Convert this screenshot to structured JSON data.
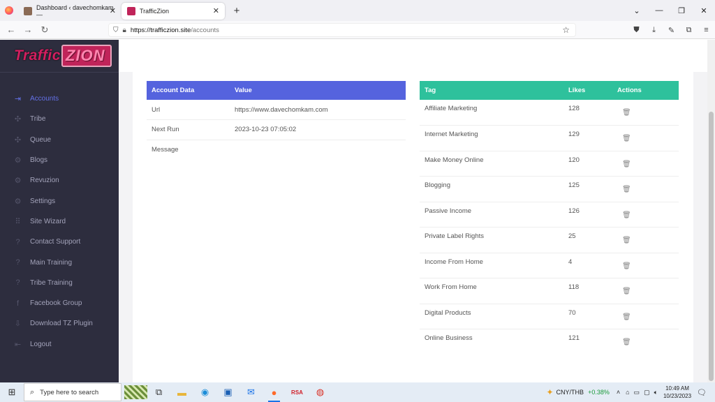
{
  "browser": {
    "tabs": [
      {
        "title": "Dashboard ‹ davechomkam —",
        "close": "✕"
      },
      {
        "title": "TrafficZion",
        "close": "✕"
      }
    ],
    "new_tab": "+",
    "url_host": "https://trafficzion.site",
    "url_path": "/accounts",
    "window_controls": [
      "⌄",
      "—",
      "❐",
      "✕"
    ]
  },
  "logo": {
    "part1": "Traffic",
    "part2": "ZION"
  },
  "sidebar": {
    "items": [
      {
        "label": "Accounts",
        "icon": "login-icon",
        "glyph": "⇥",
        "active": true
      },
      {
        "label": "Tribe",
        "icon": "network-icon",
        "glyph": "✣"
      },
      {
        "label": "Queue",
        "icon": "network-icon",
        "glyph": "✣"
      },
      {
        "label": "Blogs",
        "icon": "gear-icon",
        "glyph": "⚙"
      },
      {
        "label": "Revuzion",
        "icon": "gear-icon",
        "glyph": "⚙"
      },
      {
        "label": "Settings",
        "icon": "gear-icon",
        "glyph": "⚙"
      },
      {
        "label": "Site Wizard",
        "icon": "grid-icon",
        "glyph": "⠿"
      },
      {
        "label": "Contact Support",
        "icon": "help-icon",
        "glyph": "?"
      },
      {
        "label": "Main Training",
        "icon": "help-icon",
        "glyph": "?"
      },
      {
        "label": "Tribe Training",
        "icon": "help-icon",
        "glyph": "?"
      },
      {
        "label": "Facebook Group",
        "icon": "facebook-icon",
        "glyph": "f"
      },
      {
        "label": "Download TZ Plugin",
        "icon": "download-icon",
        "glyph": "⇩"
      },
      {
        "label": "Logout",
        "icon": "logout-icon",
        "glyph": "⇤"
      }
    ]
  },
  "account_table": {
    "headers": [
      "Account Data",
      "Value"
    ],
    "rows": [
      [
        "Url",
        "https://www.davechomkam.com"
      ],
      [
        "Next Run",
        "2023-10-23 07:05:02"
      ],
      [
        "Message",
        ""
      ]
    ]
  },
  "tag_table": {
    "headers": [
      "Tag",
      "Likes",
      "Actions"
    ],
    "rows": [
      [
        "Affiliate Marketing",
        "128"
      ],
      [
        "Internet Marketing",
        "129"
      ],
      [
        "Make Money Online",
        "120"
      ],
      [
        "Blogging",
        "125"
      ],
      [
        "Passive Income",
        "126"
      ],
      [
        "Private Label Rights",
        "25"
      ],
      [
        "Income From Home",
        "4"
      ],
      [
        "Work From Home",
        "118"
      ],
      [
        "Digital Products",
        "70"
      ],
      [
        "Online Business",
        "121"
      ]
    ],
    "action_icon": "🗑"
  },
  "taskbar": {
    "search_placeholder": "Type here to search",
    "ticker_pair": "CNY/THB",
    "ticker_change": "+0.38%",
    "time": "10:49 AM",
    "date": "10/23/2023"
  }
}
